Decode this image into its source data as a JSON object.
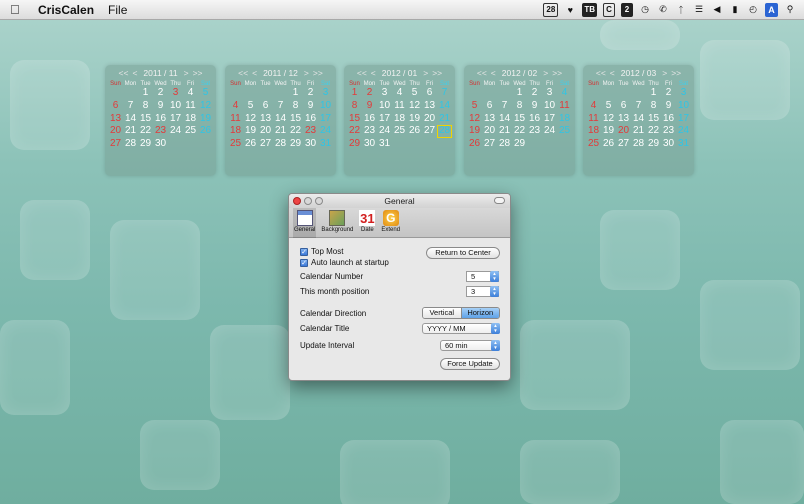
{
  "menubar": {
    "app_name": "CrisCalen",
    "menus": [
      "File"
    ],
    "status_items": [
      "28",
      "TB",
      "C",
      "2",
      "A"
    ]
  },
  "calendars": [
    {
      "prev": "<<",
      "prev1": "<",
      "title": "2011 / 11",
      "next1": ">",
      "next": ">>",
      "dow": [
        "Sun",
        "Mon",
        "Tue",
        "Wed",
        "Thu",
        "Fri",
        "Sat"
      ],
      "weeks": [
        [
          "",
          "",
          "1",
          "2",
          "3",
          "4",
          "5"
        ],
        [
          "6",
          "7",
          "8",
          "9",
          "10",
          "11",
          "12"
        ],
        [
          "13",
          "14",
          "15",
          "16",
          "17",
          "18",
          "19"
        ],
        [
          "20",
          "21",
          "22",
          "23",
          "24",
          "25",
          "26"
        ],
        [
          "27",
          "28",
          "29",
          "30",
          "",
          "",
          ""
        ]
      ],
      "holidays": [
        "3",
        "23"
      ]
    },
    {
      "prev": "<<",
      "prev1": "<",
      "title": "2011 / 12",
      "next1": ">",
      "next": ">>",
      "dow": [
        "Sun",
        "Mon",
        "Tue",
        "Wed",
        "Thu",
        "Fri",
        "Sat"
      ],
      "weeks": [
        [
          "",
          "",
          "",
          "",
          "1",
          "2",
          "3"
        ],
        [
          "4",
          "5",
          "6",
          "7",
          "8",
          "9",
          "10"
        ],
        [
          "11",
          "12",
          "13",
          "14",
          "15",
          "16",
          "17"
        ],
        [
          "18",
          "19",
          "20",
          "21",
          "22",
          "23",
          "24"
        ],
        [
          "25",
          "26",
          "27",
          "28",
          "29",
          "30",
          "31"
        ]
      ],
      "holidays": [
        "23"
      ]
    },
    {
      "prev": "<<",
      "prev1": "<",
      "title": "2012 / 01",
      "next1": ">",
      "next": ">>",
      "dow": [
        "Sun",
        "Mon",
        "Tue",
        "Wed",
        "Thu",
        "Fri",
        "Sat"
      ],
      "weeks": [
        [
          "1",
          "2",
          "3",
          "4",
          "5",
          "6",
          "7"
        ],
        [
          "8",
          "9",
          "10",
          "11",
          "12",
          "13",
          "14"
        ],
        [
          "15",
          "16",
          "17",
          "18",
          "19",
          "20",
          "21"
        ],
        [
          "22",
          "23",
          "24",
          "25",
          "26",
          "27",
          "28"
        ],
        [
          "29",
          "30",
          "31",
          "",
          "",
          "",
          ""
        ]
      ],
      "holidays": [
        "2",
        "9"
      ],
      "today": "28"
    },
    {
      "prev": "<<",
      "prev1": "<",
      "title": "2012 / 02",
      "next1": ">",
      "next": ">>",
      "dow": [
        "Sun",
        "Mon",
        "Tue",
        "Wed",
        "Thu",
        "Fri",
        "Sat"
      ],
      "weeks": [
        [
          "",
          "",
          "",
          "1",
          "2",
          "3",
          "4"
        ],
        [
          "5",
          "6",
          "7",
          "8",
          "9",
          "10",
          "11"
        ],
        [
          "12",
          "13",
          "14",
          "15",
          "16",
          "17",
          "18"
        ],
        [
          "19",
          "20",
          "21",
          "22",
          "23",
          "24",
          "25"
        ],
        [
          "26",
          "27",
          "28",
          "29",
          "",
          "",
          ""
        ]
      ],
      "holidays": [
        "11"
      ]
    },
    {
      "prev": "<<",
      "prev1": "<",
      "title": "2012 / 03",
      "next1": ">",
      "next": ">>",
      "dow": [
        "Sun",
        "Mon",
        "Tue",
        "Wed",
        "Thu",
        "Fri",
        "Sat"
      ],
      "weeks": [
        [
          "",
          "",
          "",
          "",
          "1",
          "2",
          "3"
        ],
        [
          "4",
          "5",
          "6",
          "7",
          "8",
          "9",
          "10"
        ],
        [
          "11",
          "12",
          "13",
          "14",
          "15",
          "16",
          "17"
        ],
        [
          "18",
          "19",
          "20",
          "21",
          "22",
          "23",
          "24"
        ],
        [
          "25",
          "26",
          "27",
          "28",
          "29",
          "30",
          "31"
        ]
      ],
      "holidays": [
        "20"
      ]
    }
  ],
  "window": {
    "title": "General",
    "toolbar": [
      {
        "label": "General",
        "icon": "calendar-icon"
      },
      {
        "label": "Background",
        "icon": "picture-icon"
      },
      {
        "label": "Date",
        "icon": "date-31-icon",
        "glyph": "31"
      },
      {
        "label": "Extend",
        "icon": "extend-g-icon",
        "glyph": "G"
      }
    ],
    "top_most": "Top Most",
    "auto_launch": "Auto launch at startup",
    "return_button": "Return to Center",
    "calendar_number_label": "Calendar Number",
    "calendar_number_value": "5",
    "month_position_label": "This month position",
    "month_position_value": "3",
    "direction_label": "Calendar Direction",
    "direction_options": [
      "Vertical",
      "Horizon"
    ],
    "direction_selected": "Horizon",
    "title_label": "Calendar Title",
    "title_value": "YYYY / MM",
    "interval_label": "Update Interval",
    "interval_value": "60 min",
    "force_update": "Force Update"
  }
}
